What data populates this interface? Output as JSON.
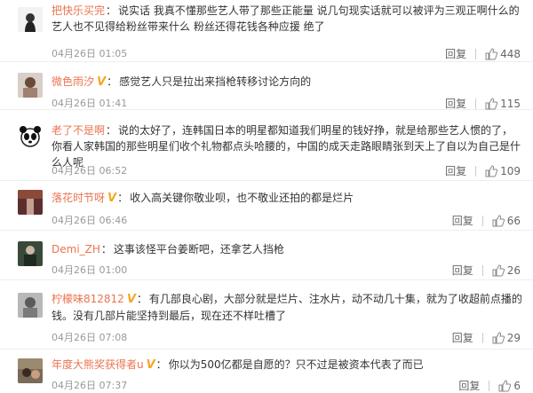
{
  "reply_label": "回复",
  "vip_mark": "V",
  "separator": "：",
  "comments": [
    {
      "user": "把快乐买完",
      "vip": false,
      "text": "说实话 我真不懂那些艺人带了那些正能量 说几句现实话就可以被评为三观正啊什么的 艺人也不见得给粉丝带来什么 粉丝还得花钱各种应援 绝了",
      "time": "04月26日 01:05",
      "likes": "448"
    },
    {
      "user": "微色雨汐",
      "vip": true,
      "text": "感觉艺人只是拉出来挡枪转移讨论方向的",
      "time": "04月26日 01:41",
      "likes": "115"
    },
    {
      "user": "老了不是啊",
      "vip": false,
      "text": "说的太好了，连韩国日本的明星都知道我们明星的钱好挣，就是给那些艺人惯的了，你看人家韩国的那些明星们收个礼物都点头哈腰的，中国的成天走路眼睛张到天上了自以为自己是什么人呢",
      "time": "04月26日 06:52",
      "likes": "109"
    },
    {
      "user": "落花时节呀",
      "vip": true,
      "text": "收入高关键你敬业呗，也不敬业还拍的都是烂片",
      "time": "04月26日 06:46",
      "likes": "66"
    },
    {
      "user": "Demi_ZH",
      "vip": false,
      "text": "这事该怪平台姜断吧，还拿艺人挡枪",
      "time": "04月26日 01:00",
      "likes": "26"
    },
    {
      "user": "柠檬味812812",
      "vip": true,
      "text": "有几部良心剧，大部分就是烂片、注水片，动不动几十集，就为了收超前点播的钱。没有几部片能坚持到最后，现在还不样吐槽了",
      "time": "04月26日 07:08",
      "likes": "29"
    },
    {
      "user": "年度大熊奖获得者u",
      "vip": true,
      "text": "你以为500亿都是自愿的？只不过是被资本代表了而已",
      "time": "04月26日 07:37",
      "likes": "6"
    }
  ]
}
